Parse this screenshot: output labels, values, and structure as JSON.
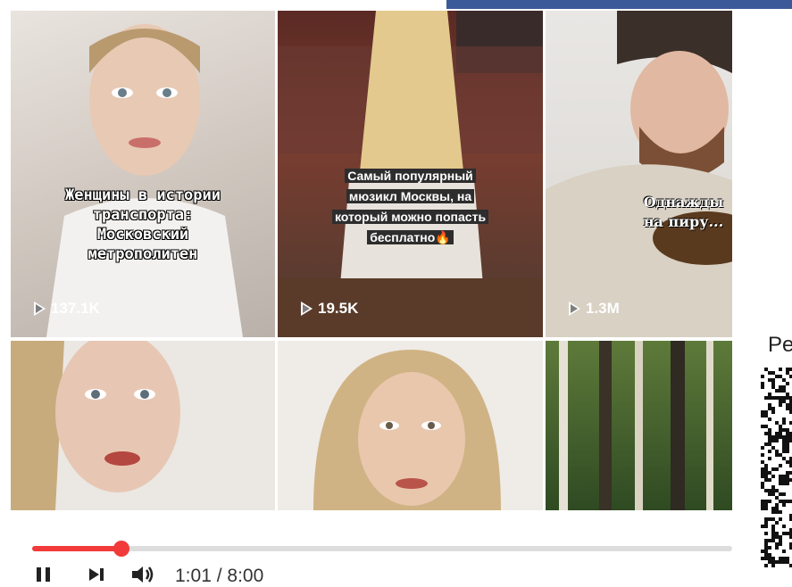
{
  "grid": {
    "tiles": [
      {
        "caption_lines": [
          "Женщины в истории",
          "транспорта:",
          "Московский",
          "метрополитен"
        ],
        "views": "137.1K"
      },
      {
        "caption_lines": [
          "Самый популярный",
          "мюзикл Москвы, на",
          "который можно попасть",
          "бесплатно🔥"
        ],
        "views": "19.5K"
      },
      {
        "caption_lines": [
          "Однажды",
          "на пиру..."
        ],
        "views": "1.3M"
      },
      {
        "caption_lines": [],
        "views": ""
      },
      {
        "caption_lines": [],
        "views": ""
      },
      {
        "caption_lines": [],
        "views": ""
      }
    ]
  },
  "side_panel": {
    "title": "Pe"
  },
  "player": {
    "current_time": "1:01",
    "separator": " / ",
    "duration": "8:00",
    "progress": 0.127
  },
  "colors": {
    "accent": "#f23a3a",
    "topbar": "#3b5998"
  }
}
